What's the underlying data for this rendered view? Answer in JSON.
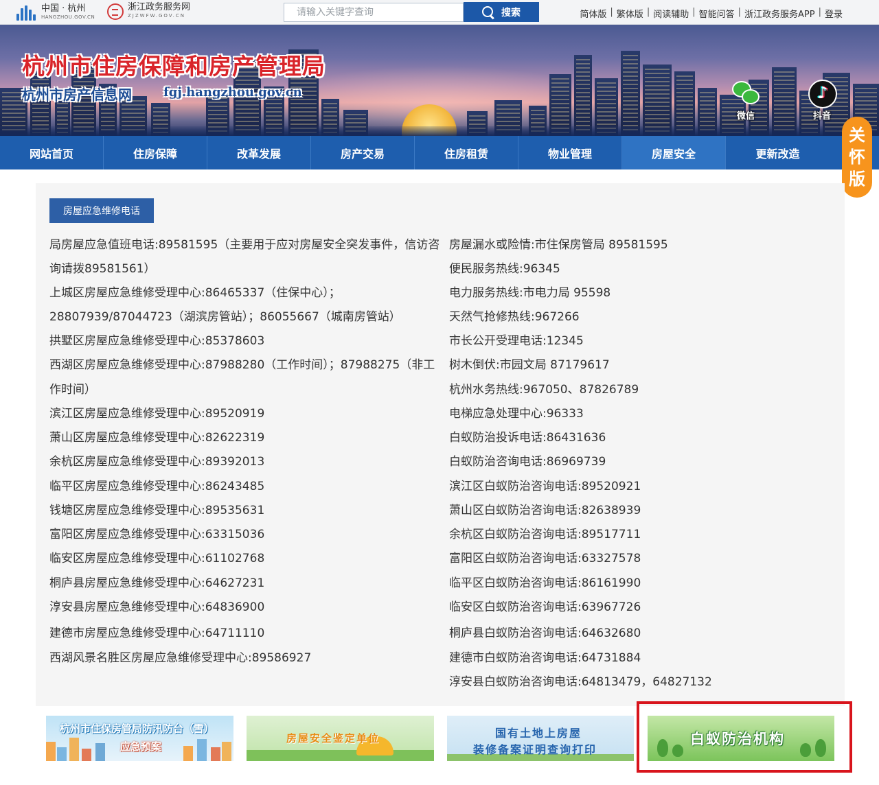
{
  "topbar": {
    "logo1": {
      "name": "中国 · 杭州",
      "domain": "HANGZHOU.GOV.CN"
    },
    "logo2": {
      "name": "浙江政务服务网",
      "domain": "ZJZWFW.GOV.CN"
    },
    "search": {
      "placeholder": "请输入关键字查询",
      "button_label": "搜索"
    },
    "links": [
      "简体版",
      "繁体版",
      "阅读辅助",
      "智能问答",
      "浙江政务服务APP",
      "登录"
    ]
  },
  "banner": {
    "title": "杭州市住房保障和房产管理局",
    "subtitle": "杭州市房产信息网",
    "domain": "fgj.hangzhou.gov.cn",
    "wechat_label": "微信",
    "douyin_label": "抖音"
  },
  "nav": {
    "items": [
      "网站首页",
      "住房保障",
      "改革发展",
      "房产交易",
      "住房租赁",
      "物业管理",
      "房屋安全",
      "更新改造"
    ],
    "active": "房屋安全"
  },
  "care_mode": {
    "chars": [
      "关",
      "怀",
      "版"
    ]
  },
  "content": {
    "category": "房屋应急维修电话",
    "left_lines": [
      "局房屋应急值班电话:89581595（主要用于应对房屋安全突发事件，信访咨",
      "询请拨89581561）",
      "上城区房屋应急维修受理中心:86465337（住保中心）；",
      "28807939/87044723（湖滨房管站）；86055667（城南房管站）",
      "拱墅区房屋应急维修受理中心:85378603",
      "西湖区房屋应急维修受理中心:87988280（工作时间）；87988275（非工",
      "作时间）",
      "滨江区房屋应急维修受理中心:89520919",
      "萧山区房屋应急维修受理中心:82622319",
      "余杭区房屋应急维修受理中心:89392013",
      "临平区房屋应急维修受理中心:86243485",
      "钱塘区房屋应急维修受理中心:89535631",
      "富阳区房屋应急维修受理中心:63315036",
      "临安区房屋应急维修受理中心:61102768",
      "桐庐县房屋应急维修受理中心:64627231",
      "淳安县房屋应急维修受理中心:64836900",
      "建德市房屋应急维修受理中心:64711110",
      "西湖风景名胜区房屋应急维修受理中心:89586927"
    ],
    "right_lines": [
      "房屋漏水或险情:市住保房管局 89581595",
      "便民服务热线:96345",
      "电力服务热线:市电力局 95598",
      "天然气抢修热线:967266",
      "市长公开受理电话:12345",
      "树木倒伏:市园文局 87179617",
      "杭州水务热线:967050、87826789",
      "电梯应急处理中心:96333",
      "白蚁防治投诉电话:86431636",
      "白蚁防治咨询电话:86969739",
      "滨江区白蚁防治咨询电话:89520921",
      "萧山区白蚁防治咨询电话:82638939",
      "余杭区白蚁防治咨询电话:89517711",
      "富阳区白蚁防治咨询电话:63327578",
      "临平区白蚁防治咨询电话:86161990",
      "临安区白蚁防治咨询电话:63967726",
      "桐庐县白蚁防治咨询电话:64632680",
      "建德市白蚁防治咨询电话:64731884",
      "淳安县白蚁防治咨询电话:64813479，64827132"
    ]
  },
  "footer_banners": {
    "b1": {
      "line1": "杭州市住保房管局防汛防台（雪）",
      "line2": "应急预案"
    },
    "b2": {
      "label": "房屋安全鉴定单位"
    },
    "b3": {
      "line1": "国有土地上房屋",
      "line2": "装修备案证明查询打印"
    },
    "b4": {
      "label": "白蚁防治机构"
    }
  },
  "colors": {
    "nav_bg": "#1e5eae",
    "search_btn": "#1c58a8",
    "care_badge": "#f7941d",
    "highlight": "#d8141c"
  }
}
